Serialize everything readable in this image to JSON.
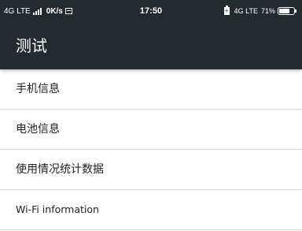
{
  "status_bar": {
    "network_left": "4G LTE",
    "data_speed": "0K/s",
    "time": "17:50",
    "network_right": "4G LTE",
    "battery_percent": "71%",
    "battery_level": 0.71,
    "background": "#232a30"
  },
  "toolbar": {
    "title": "测试",
    "background": "#232a30"
  },
  "menu": {
    "items": [
      {
        "label": "手机信息"
      },
      {
        "label": "电池信息"
      },
      {
        "label": "使用情况统计数据"
      },
      {
        "label": "Wi-Fi information"
      }
    ]
  }
}
